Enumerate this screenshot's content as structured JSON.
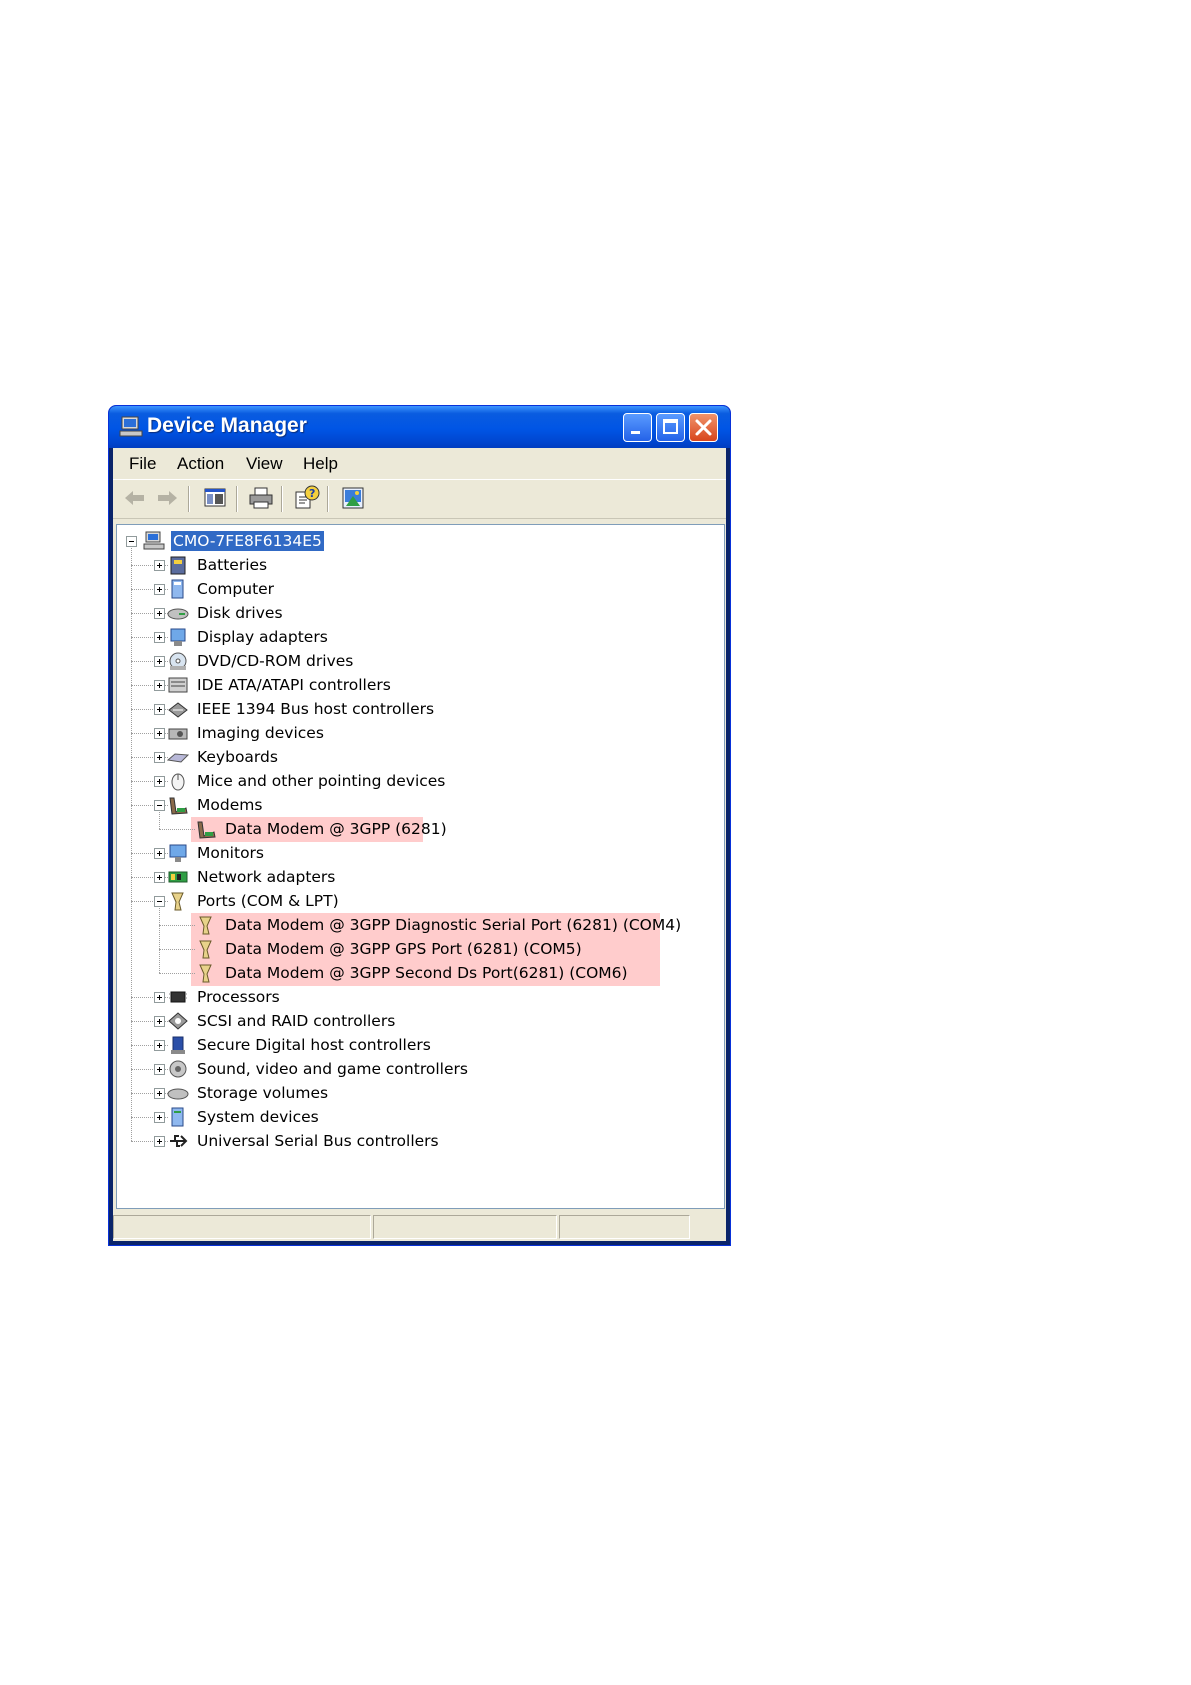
{
  "window": {
    "title": "Device Manager"
  },
  "menu": {
    "items": [
      "File",
      "Action",
      "View",
      "Help"
    ]
  },
  "toolbar": {
    "buttons": [
      "back-arrow-icon",
      "forward-arrow-icon",
      "show-hide-console-tree-icon",
      "print-icon",
      "properties-help-icon",
      "scan-hardware-icon"
    ]
  },
  "tree": {
    "root": "CMO-7FE8F6134E5",
    "items": [
      {
        "label": "Batteries",
        "icon": "battery-icon",
        "expanded": false
      },
      {
        "label": "Computer",
        "icon": "computer-icon",
        "expanded": false
      },
      {
        "label": "Disk drives",
        "icon": "disk-drive-icon",
        "expanded": false
      },
      {
        "label": "Display adapters",
        "icon": "display-adapter-icon",
        "expanded": false
      },
      {
        "label": "DVD/CD-ROM drives",
        "icon": "cdrom-icon",
        "expanded": false
      },
      {
        "label": "IDE ATA/ATAPI controllers",
        "icon": "ide-controller-icon",
        "expanded": false
      },
      {
        "label": "IEEE 1394 Bus host controllers",
        "icon": "ieee1394-icon",
        "expanded": false
      },
      {
        "label": "Imaging devices",
        "icon": "imaging-device-icon",
        "expanded": false
      },
      {
        "label": "Keyboards",
        "icon": "keyboard-icon",
        "expanded": false
      },
      {
        "label": "Mice and other pointing devices",
        "icon": "mouse-icon",
        "expanded": false
      },
      {
        "label": "Modems",
        "icon": "modem-icon",
        "expanded": true
      },
      {
        "label": "Data Modem @ 3GPP (6281)",
        "icon": "modem-icon",
        "child": true
      },
      {
        "label": "Monitors",
        "icon": "monitor-icon",
        "expanded": false
      },
      {
        "label": "Network adapters",
        "icon": "network-adapter-icon",
        "expanded": false
      },
      {
        "label": "Ports (COM & LPT)",
        "icon": "port-icon",
        "expanded": true
      },
      {
        "label": "Data Modem @ 3GPP Diagnostic Serial Port (6281) (COM4)",
        "icon": "port-icon",
        "child": true
      },
      {
        "label": "Data Modem @ 3GPP GPS Port (6281) (COM5)",
        "icon": "port-icon",
        "child": true
      },
      {
        "label": "Data Modem @ 3GPP Second Ds Port(6281) (COM6)",
        "icon": "port-icon",
        "child": true
      },
      {
        "label": "Processors",
        "icon": "processor-icon",
        "expanded": false
      },
      {
        "label": "SCSI and RAID controllers",
        "icon": "scsi-icon",
        "expanded": false
      },
      {
        "label": "Secure Digital host controllers",
        "icon": "sd-host-icon",
        "expanded": false
      },
      {
        "label": "Sound, video and game controllers",
        "icon": "sound-icon",
        "expanded": false
      },
      {
        "label": "Storage volumes",
        "icon": "storage-volume-icon",
        "expanded": false
      },
      {
        "label": "System devices",
        "icon": "system-device-icon",
        "expanded": false
      },
      {
        "label": "Universal Serial Bus controllers",
        "icon": "usb-icon",
        "expanded": false
      }
    ]
  },
  "colors": {
    "title_bar": "#0055e5",
    "selection": "#316ac5",
    "highlight": "#ffcccc",
    "chrome": "#ece9d8"
  }
}
